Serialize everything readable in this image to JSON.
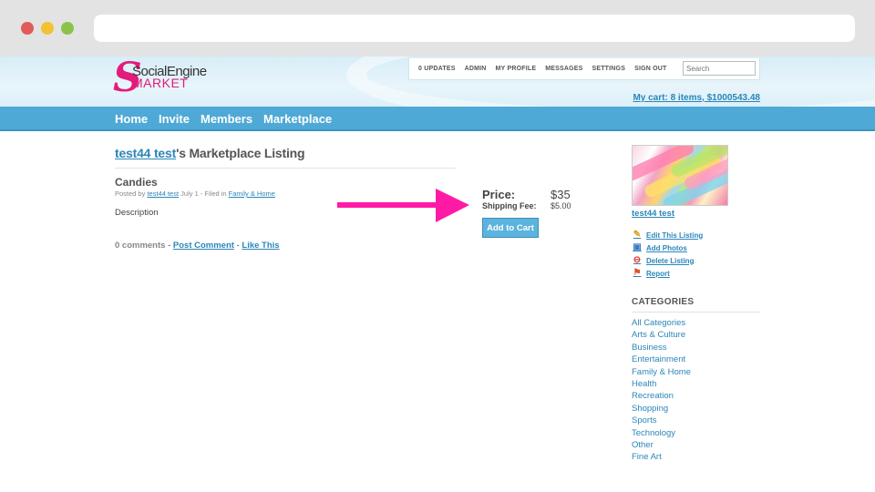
{
  "header": {
    "logo_top": "SocialEngine",
    "logo_bottom": "MARKET",
    "menu": [
      "0 UPDATES",
      "ADMIN",
      "MY PROFILE",
      "MESSAGES",
      "SETTINGS",
      "SIGN OUT"
    ],
    "search_placeholder": "Search",
    "cart": "My cart: 8 items, $1000543.48"
  },
  "nav": [
    "Home",
    "Invite",
    "Members",
    "Marketplace"
  ],
  "listing": {
    "title_user": "test44 test",
    "title_rest": "'s Marketplace Listing",
    "item_title": "Candies",
    "meta_prefix": "Posted by ",
    "meta_user": "test44 test",
    "meta_mid": " July 1 - Filed in ",
    "meta_category": "Family & Home",
    "description": "Description",
    "comments_count": "0 comments",
    "sep": " - ",
    "post_comment": "Post Comment",
    "like_this": "Like This"
  },
  "purchase": {
    "price_label": "Price:",
    "price": "$35",
    "shipping_label": "Shipping Fee:",
    "shipping": "$5.00",
    "add_to_cart": "Add to Cart"
  },
  "sidebar": {
    "owner": "test44 test",
    "actions": [
      {
        "label": "Edit This Listing",
        "icon": "pencil-icon"
      },
      {
        "label": "Add Photos",
        "icon": "photo-icon"
      },
      {
        "label": "Delete Listing",
        "icon": "delete-icon"
      },
      {
        "label": "Report",
        "icon": "flag-icon"
      }
    ],
    "categories_heading": "CATEGORIES",
    "categories": [
      "All Categories",
      "Arts & Culture",
      "Business",
      "Entertainment",
      "Family & Home",
      "Health",
      "Recreation",
      "Shopping",
      "Sports",
      "Technology",
      "Other",
      "Fine Art"
    ]
  },
  "colors": {
    "accent": "#2a86b8",
    "nav": "#4fa9d6",
    "arrow": "#ff1aa6"
  }
}
